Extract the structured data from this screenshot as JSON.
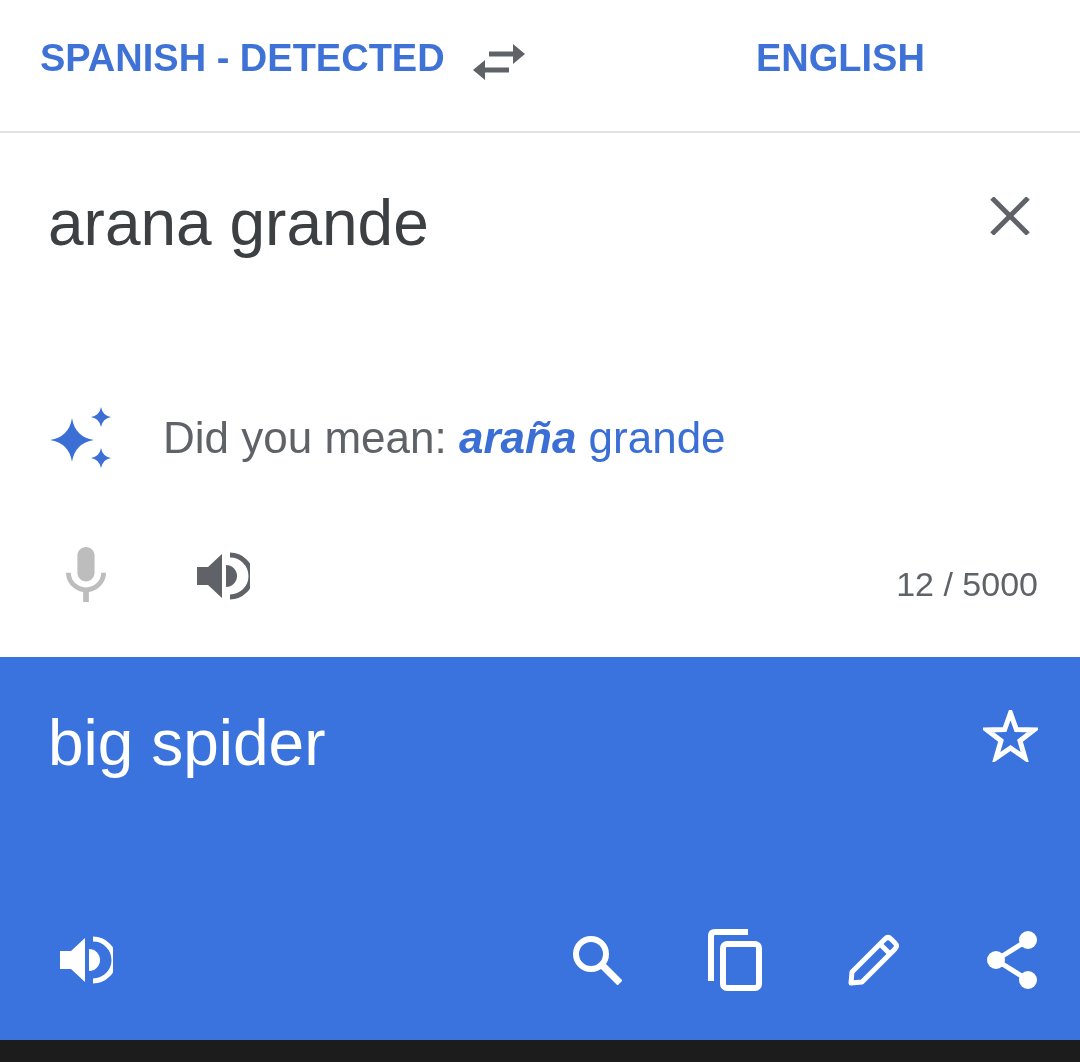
{
  "languages": {
    "source": "SPANISH - DETECTED",
    "target": "ENGLISH"
  },
  "input": {
    "value": "arana grande",
    "suggestion": {
      "label": "Did you mean:",
      "text": "**araña** grande"
    },
    "mic_disabled": true,
    "char_count": "12 / 5000"
  },
  "output": {
    "text": "big spider",
    "saved": false
  }
}
